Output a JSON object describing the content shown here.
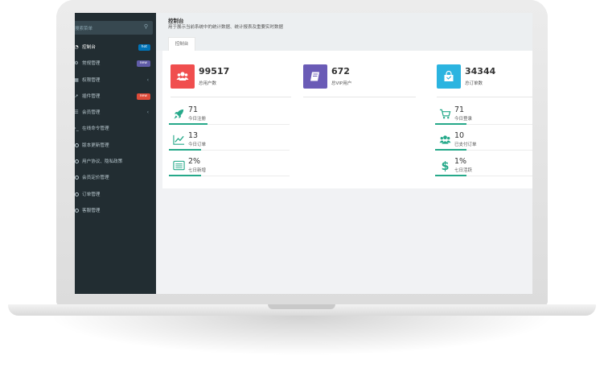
{
  "sidebar": {
    "search_placeholder": "搜索菜单",
    "items": [
      {
        "label": "控制台",
        "icon": "dashboard-icon",
        "badge": "hot",
        "badge_color": "#0073b7",
        "active": true
      },
      {
        "label": "常规管理",
        "icon": "cogs-icon",
        "badge": "new",
        "badge_color": "#605ca8"
      },
      {
        "label": "权限管理",
        "icon": "group-icon",
        "chevron": "‹"
      },
      {
        "label": "插件管理",
        "icon": "rocket-icon",
        "badge": "new",
        "badge_color": "#dd4b39"
      },
      {
        "label": "会员管理",
        "icon": "list-icon",
        "chevron": "‹"
      },
      {
        "label": "在线命令管理",
        "icon": "terminal-icon"
      },
      {
        "label": "版本更新管理",
        "icon": "circle-icon"
      },
      {
        "label": "用户协议、隐私政策",
        "icon": "circle-icon"
      },
      {
        "label": "会员定价管理",
        "icon": "circle-icon"
      },
      {
        "label": "订单管理",
        "icon": "circle-icon"
      },
      {
        "label": "客服管理",
        "icon": "circle-icon"
      }
    ]
  },
  "header": {
    "title": "控制台",
    "description": "用于展示当前系统中的统计数据、统计报表及重要实时数据",
    "tab": "控制台"
  },
  "stats": {
    "big": [
      {
        "value": "99517",
        "label": "总用户数",
        "color": "#f04e4e",
        "icon": "users-icon"
      },
      {
        "value": "672",
        "label": "总VIP用户",
        "color": "#6a5bb6",
        "icon": "book-icon"
      },
      {
        "value": "34344",
        "label": "总订单数",
        "color": "#2bb4e0",
        "icon": "shopping-bag-icon"
      }
    ],
    "small_left": [
      {
        "value": "71",
        "label": "今日注册",
        "icon": "rocket-icon",
        "progress": 0.5
      },
      {
        "value": "13",
        "label": "今日订单",
        "icon": "line-chart-icon",
        "progress": 0.42
      },
      {
        "value": "2%",
        "label": "七日新增",
        "icon": "list-alt-icon",
        "progress": 0.42
      }
    ],
    "small_right": [
      {
        "value": "71",
        "label": "今日登录",
        "icon": "cart-icon",
        "progress": 0.58
      },
      {
        "value": "10",
        "label": "已支付订单",
        "icon": "users-icon",
        "progress": 0.58
      },
      {
        "value": "1%",
        "label": "七日活跃",
        "icon": "dollar-icon",
        "progress": 0.58
      }
    ]
  },
  "colors": {
    "accent": "#26a98a",
    "sidebar_bg": "#222d32"
  }
}
